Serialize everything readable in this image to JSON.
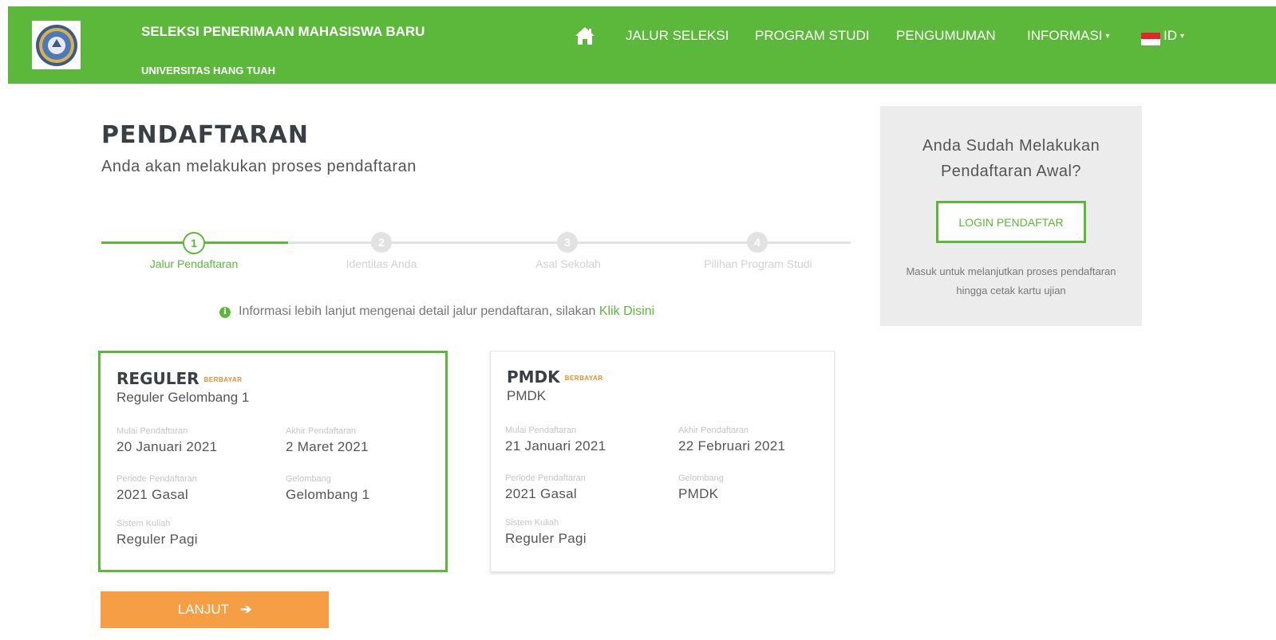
{
  "navbar": {
    "brand_title": "SELEKSI PENERIMAAN MAHASISWA BARU",
    "brand_subtitle": "UNIVERSITAS HANG TUAH",
    "home_icon": "home-icon",
    "menu": {
      "jalur": "JALUR SELEKSI",
      "prodi": "PROGRAM STUDI",
      "pengumuman": "PENGUMUMAN",
      "informasi": "INFORMASI",
      "language": "ID"
    },
    "color": "#5cb83a"
  },
  "page": {
    "title": "PENDAFTARAN",
    "subtitle": "Anda akan melakukan proses pendaftaran"
  },
  "stepper": {
    "steps": [
      {
        "number": "1",
        "label": "Jalur Pendaftaran",
        "active": true
      },
      {
        "number": "2",
        "label": "Identitas Anda",
        "active": false
      },
      {
        "number": "3",
        "label": "Asal Sekolah",
        "active": false
      },
      {
        "number": "4",
        "label": "Pilihan Program Studi",
        "active": false
      }
    ]
  },
  "info": {
    "text": "Informasi lebih lanjut mengenai detail jalur pendaftaran, silakan",
    "link": "Klik Disini"
  },
  "labels": {
    "mulai": "Mulai Pendaftaran",
    "akhir": "Akhir Pendaftaran",
    "periode": "Periode Pendaftaran",
    "gelombang": "Gelombang",
    "sistem": "Sistem Kuliah"
  },
  "cards": [
    {
      "name": "REGULER",
      "badge": "BERBAYAR",
      "description": "Reguler Gelombang 1",
      "mulai": "20 Januari 2021",
      "akhir": "2 Maret 2021",
      "periode": "2021 Gasal",
      "gelombang": "Gelombang 1",
      "sistem": "Reguler Pagi",
      "selected": true
    },
    {
      "name": "PMDK",
      "badge": "BERBAYAR",
      "description": "PMDK",
      "mulai": "21 Januari 2021",
      "akhir": "22 Februari 2021",
      "periode": "2021 Gasal",
      "gelombang": "PMDK",
      "sistem": "Reguler Pagi",
      "selected": false
    }
  ],
  "next_button": {
    "label": "LANJUT",
    "icon": "arrow-right-icon",
    "color": "#f59e44"
  },
  "login_panel": {
    "question": "Anda Sudah Melakukan Pendaftaran Awal?",
    "button": "LOGIN PENDAFTAR",
    "help": "Masuk untuk melanjutkan proses pendaftaran hingga cetak kartu ujian"
  }
}
